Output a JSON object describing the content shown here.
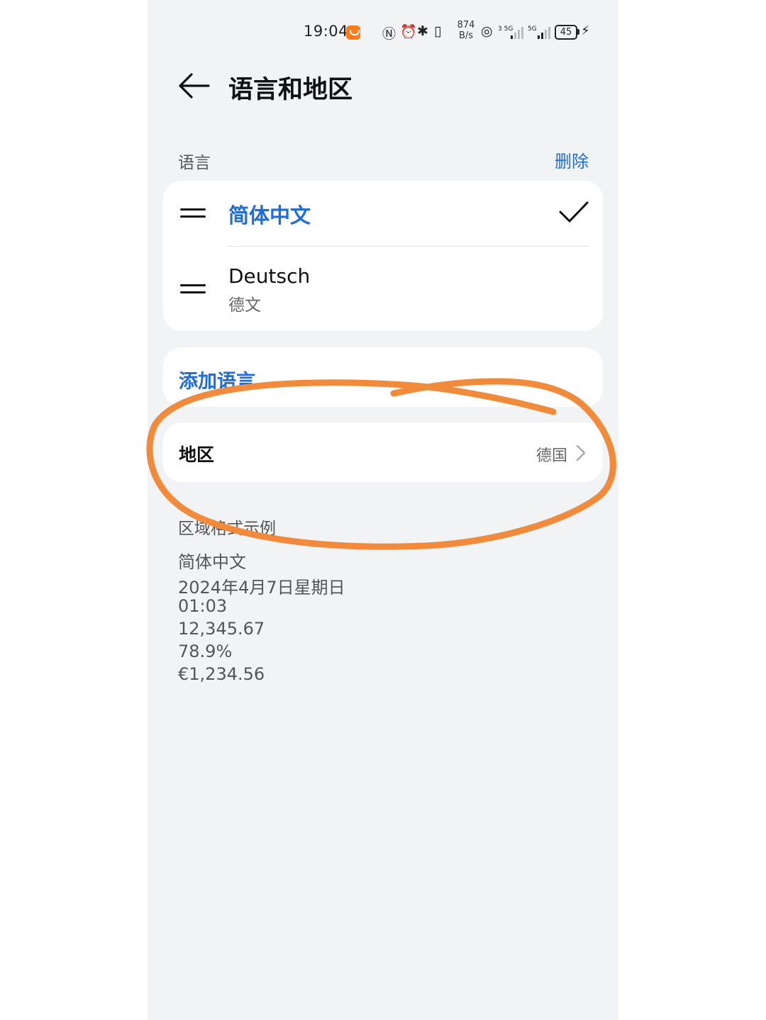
{
  "status_bar": {
    "time": "19:04",
    "speed_value": "874",
    "speed_unit": "B/s",
    "battery": "45",
    "icons": [
      "notification-app-icon",
      "nfc-icon",
      "alarm-icon",
      "bluetooth-icon",
      "vibrate-icon",
      "hotspot-icon",
      "signal-5g-icon",
      "signal-5g-icon",
      "battery-icon",
      "charging-icon"
    ]
  },
  "header": {
    "title": "语言和地区",
    "back_icon": "arrow-left-icon"
  },
  "language_section": {
    "label": "语言",
    "delete_label": "删除",
    "languages": [
      {
        "name": "简体中文",
        "selected": true
      },
      {
        "name": "Deutsch",
        "subtitle": "德文",
        "selected": false
      }
    ]
  },
  "add_language": {
    "label": "添加语言"
  },
  "region": {
    "label": "地区",
    "value": "德国"
  },
  "format_examples": {
    "title": "区域格式示例",
    "lines": [
      "简体中文",
      "2024年4月7日星期日",
      "01:03",
      "12,345.67",
      "78.9%",
      "€1,234.56"
    ]
  },
  "colors": {
    "accent": "#1f6be0",
    "background": "#f1f3f5",
    "annotation": "#f28a3c"
  }
}
